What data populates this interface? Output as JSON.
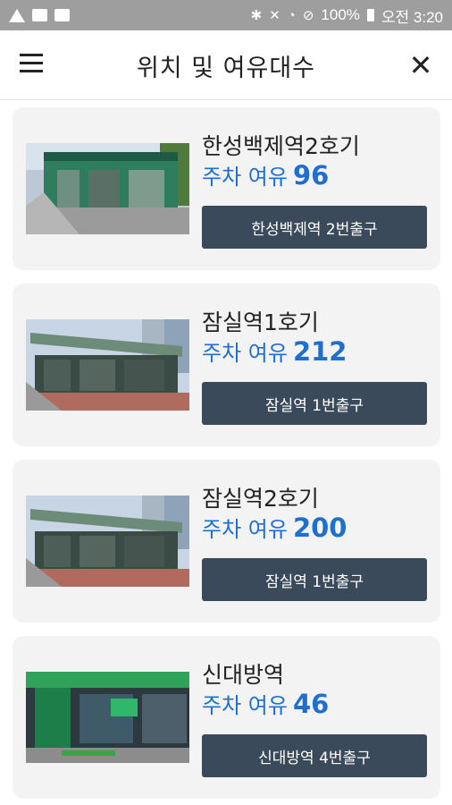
{
  "status_bar": {
    "battery": "100%",
    "time": "오전 3:20"
  },
  "header": {
    "title": "위치 및 여유대수"
  },
  "stations": [
    {
      "name": "한성백제역2호기",
      "availability_label": "주차 여유",
      "count": "96",
      "button_label": "한성백제역 2번출구"
    },
    {
      "name": "잠실역1호기",
      "availability_label": "주차 여유",
      "count": "212",
      "button_label": "잠실역 1번출구"
    },
    {
      "name": "잠실역2호기",
      "availability_label": "주차 여유",
      "count": "200",
      "button_label": "잠실역 1번출구"
    },
    {
      "name": "신대방역",
      "availability_label": "주차 여유",
      "count": "46",
      "button_label": "신대방역 4번출구"
    }
  ]
}
